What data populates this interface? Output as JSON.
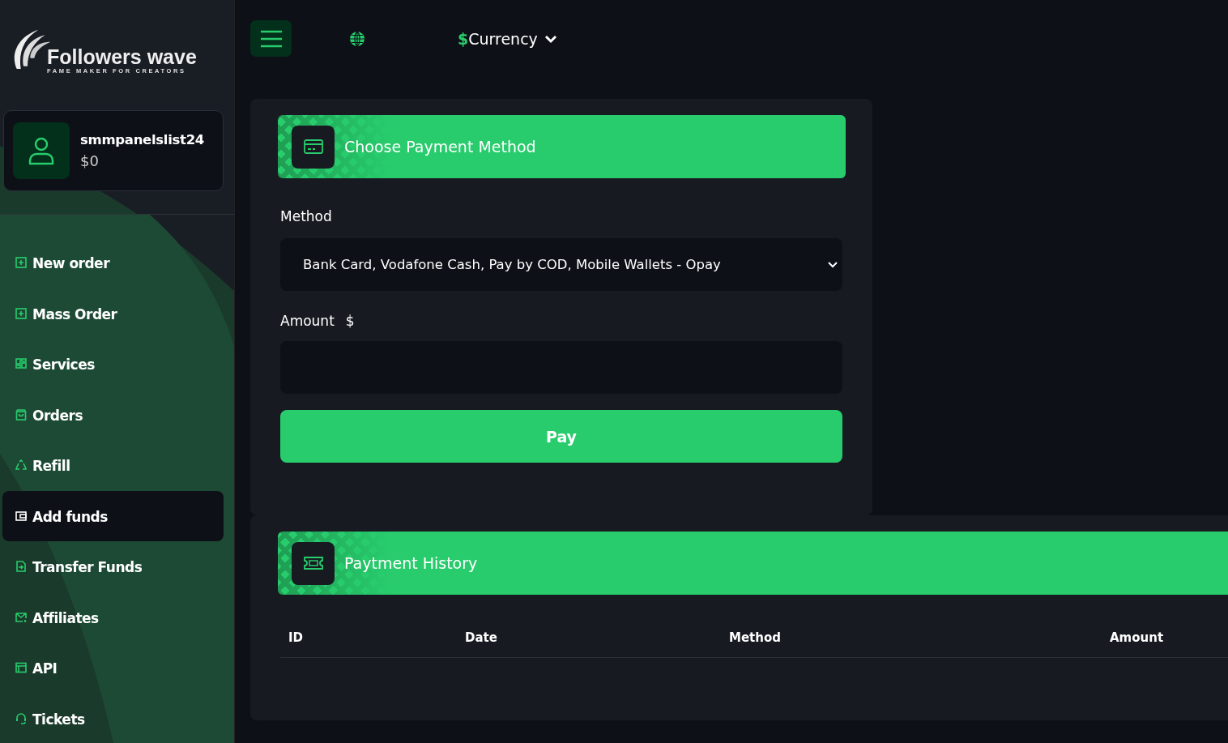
{
  "logo": {
    "title": "Followers wave",
    "tagline": "FAME MAKER FOR CREATORS"
  },
  "user": {
    "name": "smmpanelslist24",
    "balance": "$0"
  },
  "sidebar": {
    "items": [
      {
        "label": "New order",
        "selected": false
      },
      {
        "label": "Mass Order",
        "selected": false
      },
      {
        "label": "Services",
        "selected": false
      },
      {
        "label": "Orders",
        "selected": false
      },
      {
        "label": "Refill",
        "selected": false
      },
      {
        "label": "Add funds",
        "selected": true
      },
      {
        "label": "Transfer Funds",
        "selected": false
      },
      {
        "label": "Affiliates",
        "selected": false
      },
      {
        "label": "API",
        "selected": false
      },
      {
        "label": "Tickets",
        "selected": false
      }
    ]
  },
  "topbar": {
    "currency_symbol": "$",
    "currency_label": "Currency"
  },
  "payment_card": {
    "title": "Choose Payment Method",
    "method_label": "Method",
    "method_value": "Bank Card, Vodafone Cash, Pay by COD, Mobile Wallets - Opay",
    "amount_label": "Amount",
    "amount_unit": "$",
    "pay_button": "Pay"
  },
  "history_card": {
    "title": "Paytment History",
    "columns": [
      "ID",
      "Date",
      "Method",
      "Amount"
    ]
  }
}
